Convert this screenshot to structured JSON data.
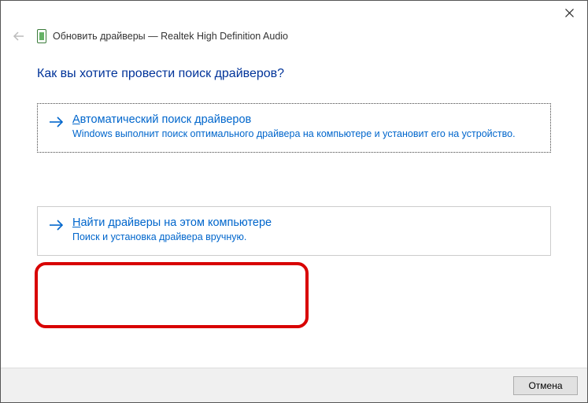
{
  "window": {
    "title_prefix": "Обновить драйверы —",
    "device_name": "Realtek High Definition Audio"
  },
  "heading": "Как вы хотите провести поиск драйверов?",
  "options": [
    {
      "accel": "А",
      "title_rest": "втоматический поиск драйверов",
      "desc": "Windows выполнит поиск оптимального драйвера на компьютере и установит его на устройство."
    },
    {
      "accel": "Н",
      "title_rest": "айти драйверы на этом компьютере",
      "desc": "Поиск и установка драйвера вручную."
    }
  ],
  "footer": {
    "cancel": "Отмена"
  }
}
